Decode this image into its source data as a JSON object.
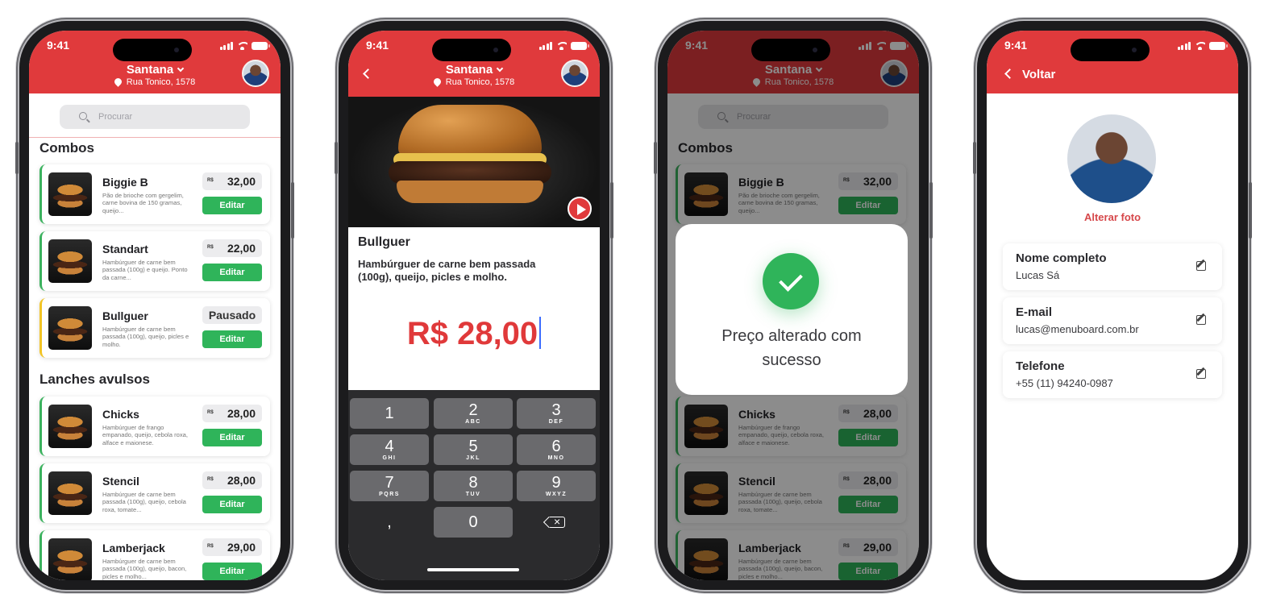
{
  "status": {
    "time": "9:41"
  },
  "location": {
    "store": "Santana",
    "address": "Rua Tonico, 1578"
  },
  "search": {
    "placeholder": "Procurar"
  },
  "sections": {
    "combos": "Combos",
    "avulsos": "Lanches avulsos"
  },
  "currency_small": "R$",
  "edit_label": "Editar",
  "paused_label": "Pausado",
  "combos": [
    {
      "name": "Biggie B",
      "desc": "Pão de brioche com gergelim, carne bovina de 150 gramas, queijo...",
      "price": "32,00",
      "status": "active"
    },
    {
      "name": "Standart",
      "desc": "Hambúrguer de carne bem passada (100g) e queijo. Ponto da carne...",
      "price": "22,00",
      "status": "active"
    },
    {
      "name": "Bullguer",
      "desc": "Hambúrguer de carne bem passada (100g), queijo, picles e molho.",
      "price": "",
      "status": "paused"
    }
  ],
  "avulsos": [
    {
      "name": "Chicks",
      "desc": "Hambúrguer de frango empanado, queijo, cebola roxa, alface e maionese.",
      "price": "28,00"
    },
    {
      "name": "Stencil",
      "desc": "Hambúrguer de carne bem passada (100g), queijo, cebola roxa, tomate...",
      "price": "28,00"
    },
    {
      "name": "Lamberjack",
      "desc": "Hambúrguer de carne bem passada (100g), queijo, bacon, picles e molho...",
      "price": "29,00"
    }
  ],
  "detail": {
    "name": "Bullguer",
    "desc": "Hambúrguer de carne bem passada (100g), queijo, picles e molho.",
    "price": "R$ 28,00"
  },
  "keypad": [
    {
      "num": "1",
      "letters": ""
    },
    {
      "num": "2",
      "letters": "ABC"
    },
    {
      "num": "3",
      "letters": "DEF"
    },
    {
      "num": "4",
      "letters": "GHI"
    },
    {
      "num": "5",
      "letters": "JKL"
    },
    {
      "num": "6",
      "letters": "MNO"
    },
    {
      "num": "7",
      "letters": "PQRS"
    },
    {
      "num": "8",
      "letters": "TUV"
    },
    {
      "num": "9",
      "letters": "WXYZ"
    },
    {
      "num": ",",
      "letters": ""
    },
    {
      "num": "0",
      "letters": ""
    },
    {
      "num": "",
      "letters": ""
    }
  ],
  "success": {
    "message": "Preço alterado com sucesso"
  },
  "profile": {
    "back_label": "Voltar",
    "change_photo": "Alterar foto",
    "fields": [
      {
        "label": "Nome completo",
        "value": "Lucas Sá"
      },
      {
        "label": "E-mail",
        "value": "lucas@menuboard.com.br"
      },
      {
        "label": "Telefone",
        "value": "+55 (11) 94240-0987"
      }
    ]
  },
  "colors": {
    "brand": "#e03a3c",
    "success": "#2fb45a",
    "paused": "#f2c425"
  }
}
